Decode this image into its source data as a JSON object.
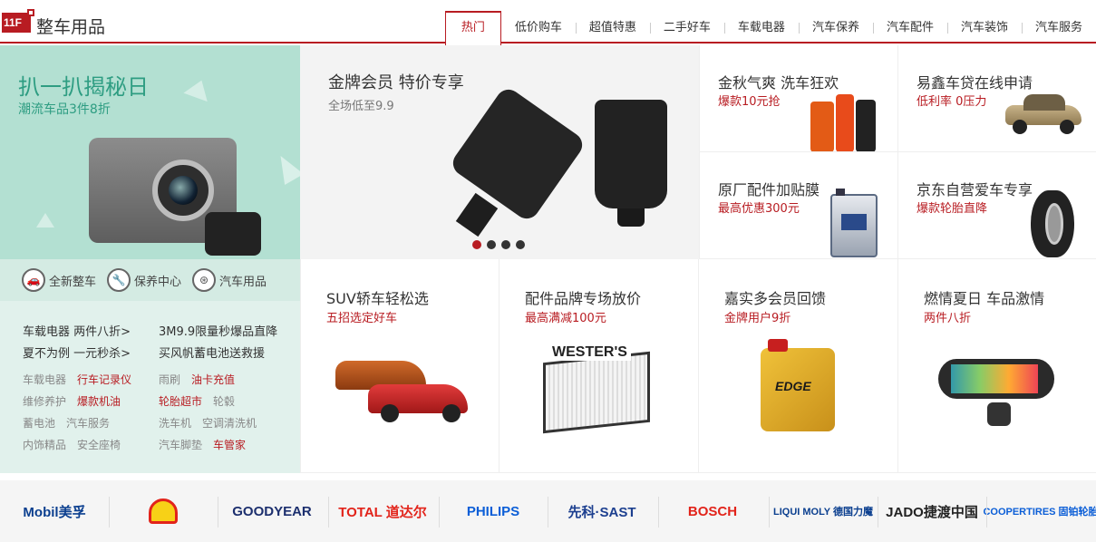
{
  "floor": {
    "badge": "11F",
    "title": "整车用品",
    "tabs": [
      "热门",
      "低价购车",
      "超值特惠",
      "二手好车",
      "车载电器",
      "汽车保养",
      "汽车配件",
      "汽车装饰",
      "汽车服务"
    ]
  },
  "hero": {
    "title": "扒一扒揭秘日",
    "subtitle": "潮流车品3件8折"
  },
  "quick_links": [
    {
      "icon": "car-icon",
      "label": "全新整车"
    },
    {
      "icon": "maintenance-icon",
      "label": "保养中心"
    },
    {
      "icon": "steering-wheel-icon",
      "label": "汽车用品"
    }
  ],
  "promos": [
    [
      "车载电器 两件八折>",
      "3M9.9限量秒爆品直降"
    ],
    [
      "夏不为例 一元秒杀>",
      "买风帆蓄电池送救援"
    ]
  ],
  "keywords": [
    [
      {
        "t": "车载电器",
        "hot": false
      },
      {
        "t": "行车记录仪",
        "hot": true
      },
      {
        "t": "雨刷",
        "hot": false
      },
      {
        "t": "油卡充值",
        "hot": true
      }
    ],
    [
      {
        "t": "维修养护",
        "hot": false
      },
      {
        "t": "爆款机油",
        "hot": true
      },
      {
        "t": "轮胎超市",
        "hot": true
      },
      {
        "t": "轮毂",
        "hot": false
      }
    ],
    [
      {
        "t": "蓄电池",
        "hot": false
      },
      {
        "t": "汽车服务",
        "hot": false
      },
      {
        "t": "洗车机",
        "hot": false
      },
      {
        "t": "空调清洗机",
        "hot": false
      }
    ],
    [
      {
        "t": "内饰精品",
        "hot": false
      },
      {
        "t": "安全座椅",
        "hot": false
      },
      {
        "t": "汽车脚垫",
        "hot": false
      },
      {
        "t": "车管家",
        "hot": true
      }
    ]
  ],
  "slider": {
    "title": "金牌会员 特价专享",
    "subtitle": "全场低至9.9",
    "active_dot": 0,
    "dot_count": 4
  },
  "cards_small": [
    {
      "title": "金秋气爽 洗车狂欢",
      "sub": "爆款10元抢",
      "img": "car-wash-bottles-icon"
    },
    {
      "title": "易鑫车贷在线申请",
      "sub": "低利率 0压力",
      "img": "sedan-icon"
    },
    {
      "title": "原厂配件加贴膜",
      "sub": "最高优惠300元",
      "img": "oil-jug-icon"
    },
    {
      "title": "京东自营爱车专享",
      "sub": "爆款轮胎直降",
      "img": "tire-icon"
    }
  ],
  "cards_bottom": [
    {
      "title": "SUV轿车轻松选",
      "sub": "五招选定好车",
      "img": "cars-icon"
    },
    {
      "title": "配件品牌专场放价",
      "sub": "最高满减100元",
      "img": "air-filter-icon",
      "brand_text": "WESTER'S"
    },
    {
      "title": "嘉实多会员回馈",
      "sub": "金牌用户9折",
      "img": "castrol-oil-icon",
      "brand_text": "EDGE"
    },
    {
      "title": "燃情夏日 车品激情",
      "sub": "两件八折",
      "img": "rearview-mirror-dvr-icon"
    }
  ],
  "brands": [
    {
      "name": "mobil-logo",
      "text": "Mobil美孚",
      "color": "#0b3f8f"
    },
    {
      "name": "shell-logo",
      "text": "",
      "color": "#e2231a"
    },
    {
      "name": "goodyear-logo",
      "text": "GOODYEAR",
      "color": "#1c2f6e"
    },
    {
      "name": "total-logo",
      "text": "TOTAL 道达尔",
      "color": "#e2231a"
    },
    {
      "name": "philips-logo",
      "text": "PHILIPS",
      "color": "#0b5ed7"
    },
    {
      "name": "sast-logo",
      "text": "先科·SAST",
      "color": "#1c3f8f"
    },
    {
      "name": "bosch-logo",
      "text": "BOSCH",
      "color": "#e2231a"
    },
    {
      "name": "liquimoly-logo",
      "text": "LIQUI MOLY 德国力魔",
      "color": "#0b3f8f"
    },
    {
      "name": "jado-logo",
      "text": "JADO捷渡中国",
      "color": "#222222"
    },
    {
      "name": "coopertires-logo",
      "text": "COOPERTIRES 固铂轮胎",
      "color": "#0b5ed7"
    }
  ]
}
